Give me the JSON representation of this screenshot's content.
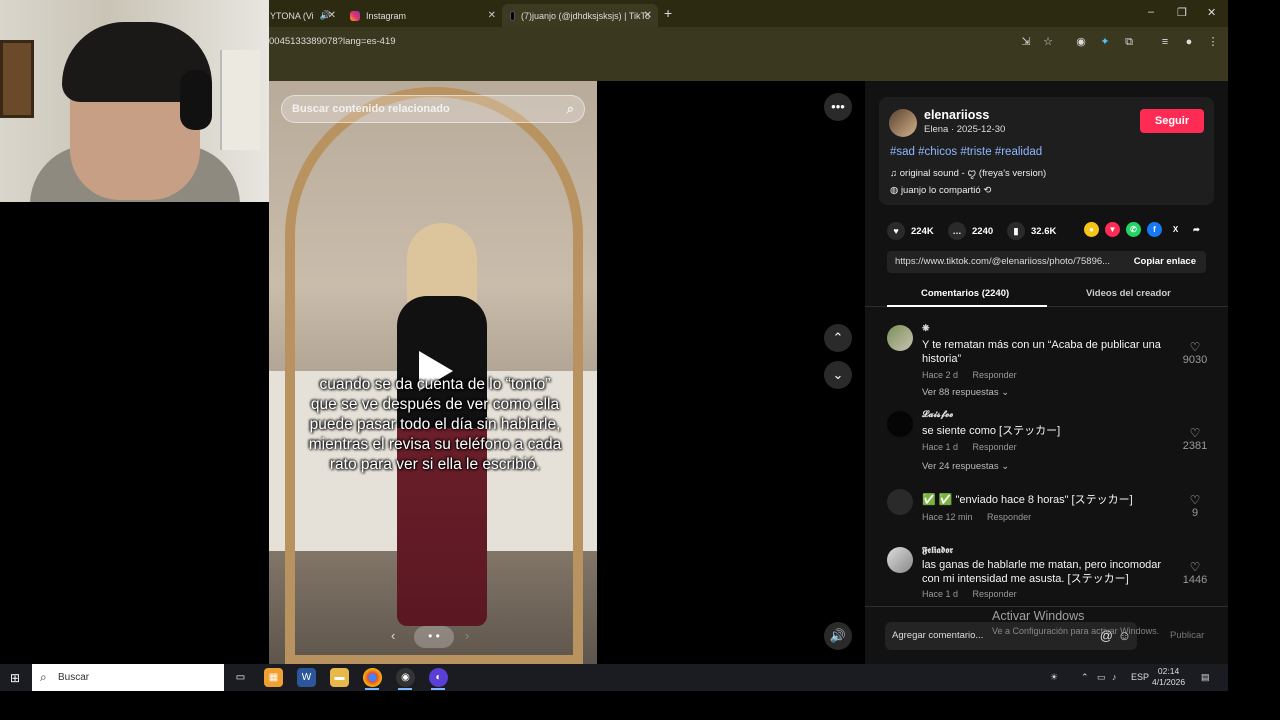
{
  "browser": {
    "tabs": [
      {
        "label": "YTONA (Vi",
        "active": false
      },
      {
        "label": "Instagram",
        "active": false
      },
      {
        "label": "(7)juanjo (@jdhdksjsksjs) | TikTo",
        "active": true
      }
    ],
    "new_tab": "+",
    "url": "0045133389078?lang=es-419",
    "window": {
      "minimize": "–",
      "restore": "❐",
      "close": "✕"
    }
  },
  "video": {
    "search_placeholder": "Buscar contenido relacionado",
    "caption": "cuando se da cuenta de lo “tonto” que se ve después de ver como ella puede pasar todo el día sin hablarle, mientras el revisa su teléfono a cada rato para ver si ella le escribió.",
    "nav_dots": "• •"
  },
  "post": {
    "username": "elenariioss",
    "subline": "Elena · 2025-12-30",
    "follow": "Seguir",
    "hashtags": "#sad #chicos #triste #realidad",
    "sound": "original sound - ꨄ (freya's version)",
    "shared_by": "juanjo lo compartió",
    "stats": {
      "likes": "224K",
      "comments": "2240",
      "saves": "32.6K"
    },
    "link": "https://www.tiktok.com/@elenariioss/photo/75896...",
    "copy_link": "Copiar enlace"
  },
  "tabs": {
    "comments": "Comentarios (2240)",
    "creator_videos": "Videos del creador"
  },
  "comments": [
    {
      "user": "❋",
      "text": "Y te rematan más con un “Acaba de publicar una historia”",
      "time": "Hace 2 d",
      "reply": "Responder",
      "likes": "9030",
      "more": "Ver 88 respuestas ⌄"
    },
    {
      "user": "𝓛𝓪𝓲𝓼𝓯𝓮𝓮",
      "text": "se siente como [ステッカー]",
      "time": "Hace 1 d",
      "reply": "Responder",
      "likes": "2381",
      "more": "Ver 24 respuestas ⌄"
    },
    {
      "user": "",
      "text": "✅ ✅ \"enviado hace 8 horas\" [ステッカー]",
      "time": "Hace 12 min",
      "reply": "Responder",
      "likes": "9",
      "more": ""
    },
    {
      "user": "𝕱𝖊𝖑𝖎𝖆𝖉𝖔𝖗",
      "text": "las ganas de hablarle me matan, pero incomodar con mi intensidad me asusta. [ステッカー]",
      "time": "Hace 1 d",
      "reply": "Responder",
      "likes": "1446",
      "more": ""
    }
  ],
  "composer": {
    "placeholder": "Agregar comentario...",
    "publish": "Publicar"
  },
  "watermark": {
    "title": "Activar Windows",
    "subtitle": "Ve a Configuración para activar Windows."
  },
  "taskbar": {
    "search": "Buscar",
    "lang": "ESP",
    "time": "02:14",
    "date": "4/1/2026"
  },
  "colors": {
    "accent": "#fe2c55",
    "hashtag": "#8fb6ff",
    "panel": "#121212"
  }
}
